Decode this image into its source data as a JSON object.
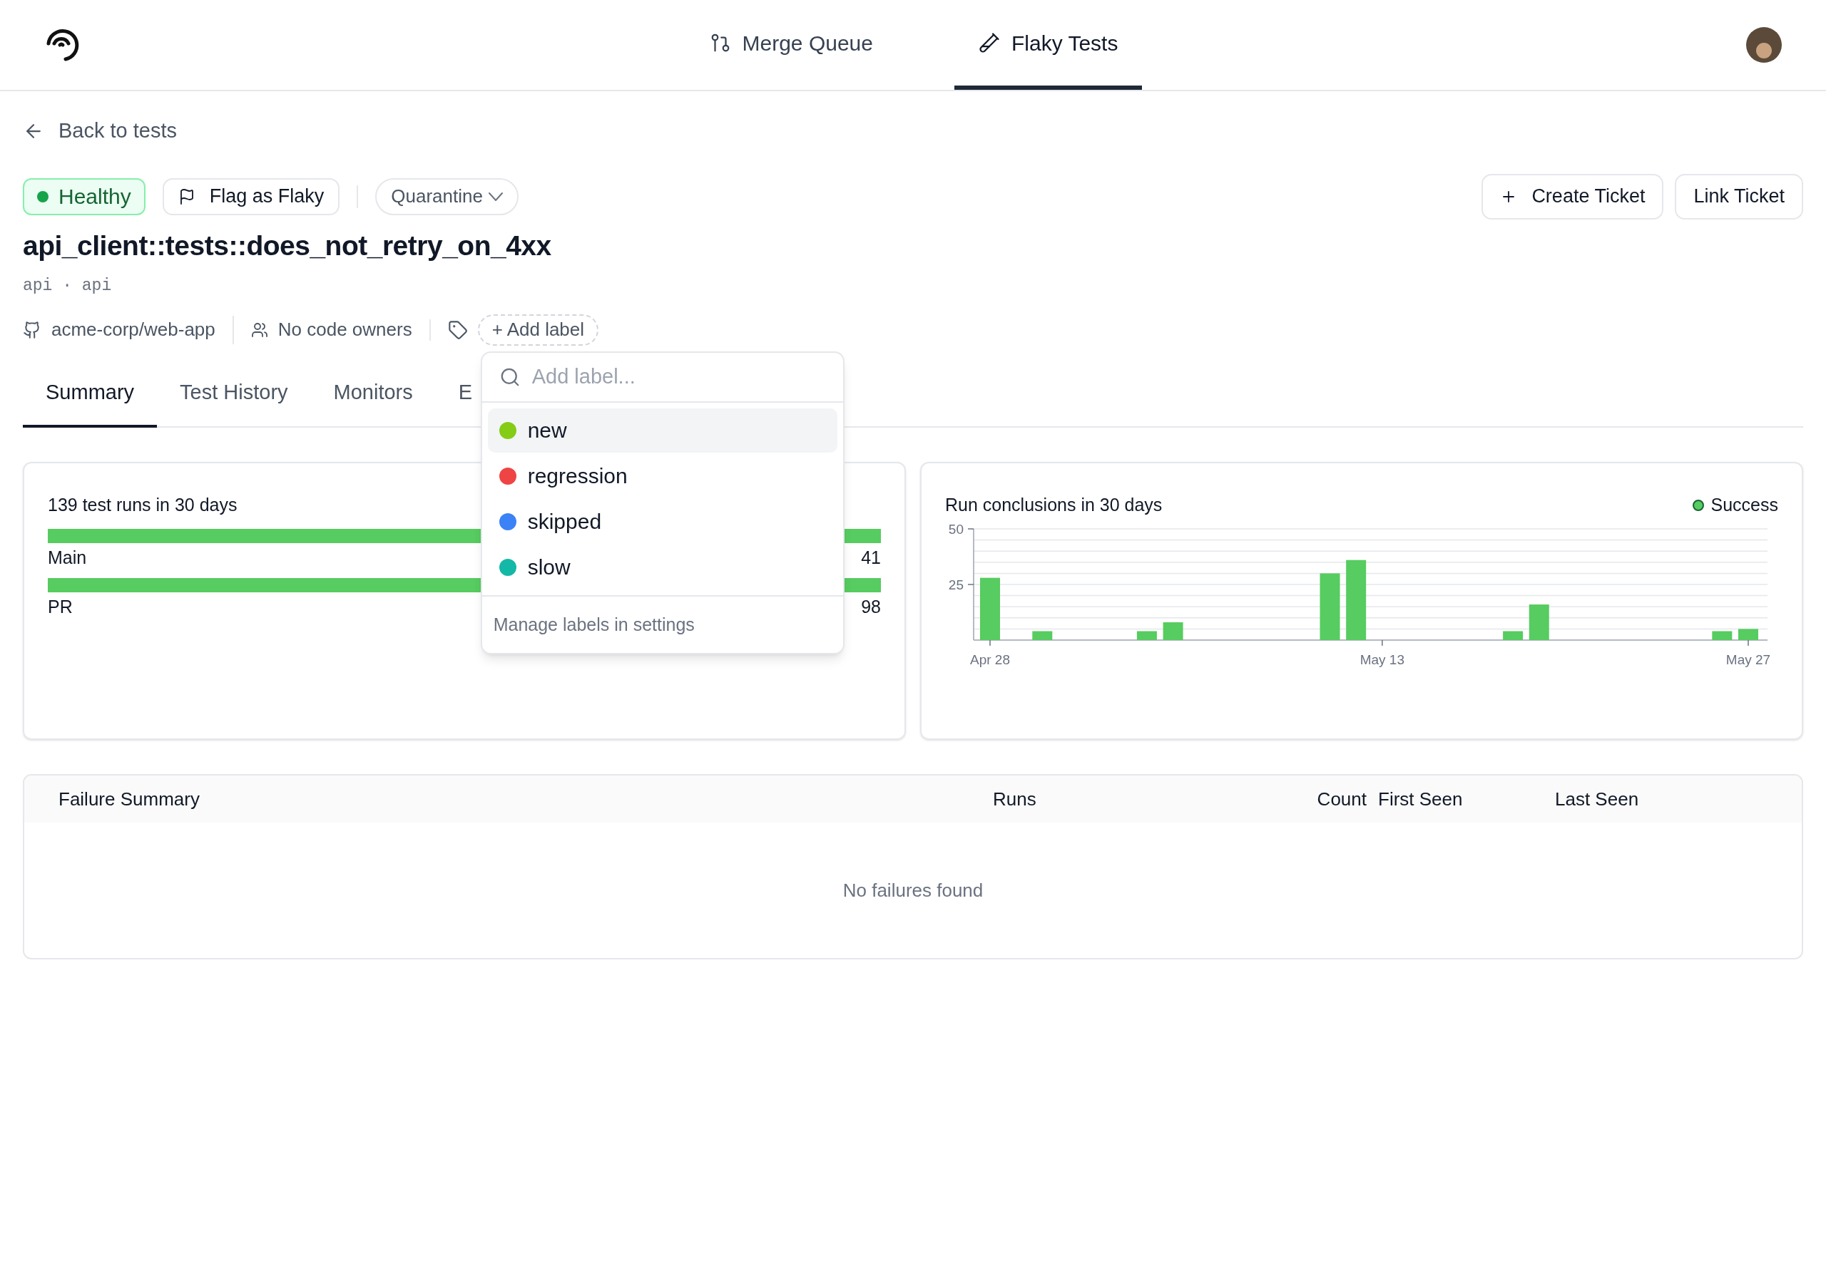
{
  "nav": {
    "tabs": [
      {
        "label": "Merge Queue",
        "selected": false
      },
      {
        "label": "Flaky Tests",
        "selected": true
      }
    ]
  },
  "back_link": "Back to tests",
  "status": {
    "label": "Healthy",
    "kind": "healthy"
  },
  "flag_button": "Flag as Flaky",
  "quarantine": "Quarantine",
  "actions": [
    "Create Ticket",
    "Link Ticket"
  ],
  "test": {
    "name": "api_client::tests::does_not_retry_on_4xx",
    "path": "api · api"
  },
  "meta": {
    "repo": "acme-corp/web-app",
    "owners": "No code owners",
    "add_label": "+ Add label"
  },
  "label_menu": {
    "placeholder": "Add label...",
    "items": [
      {
        "label": "new",
        "color": "#84cc16",
        "selected": true
      },
      {
        "label": "regression",
        "color": "#ef4444",
        "selected": false
      },
      {
        "label": "skipped",
        "color": "#3b82f6",
        "selected": false
      },
      {
        "label": "slow",
        "color": "#14b8a6",
        "selected": false
      }
    ],
    "footer": "Manage labels in settings"
  },
  "tabs": [
    {
      "label": "Summary",
      "selected": true
    },
    {
      "label": "Test History",
      "selected": false
    },
    {
      "label": "Monitors",
      "selected": false
    },
    {
      "label": "E",
      "selected": false
    }
  ],
  "runs_card": {
    "title": "139 test runs in 30 days",
    "rows": [
      {
        "label": "Main",
        "count": "41",
        "level": 1
      },
      {
        "label": "PR",
        "count": "98",
        "level": 1
      }
    ]
  },
  "conclusions_card": {
    "chart_data": {
      "type": "bar",
      "title": "Run conclusions in 30 days",
      "categories": [
        "Apr 28",
        null,
        null,
        null,
        null,
        null,
        null,
        null,
        null,
        null,
        null,
        null,
        null,
        null,
        null,
        "May 13",
        null,
        null,
        null,
        null,
        null,
        null,
        null,
        null,
        null,
        null,
        null,
        null,
        null,
        "May 27"
      ],
      "series": [
        {
          "name": "Success",
          "color": "#57cc60",
          "values": [
            28,
            0,
            4,
            0,
            0,
            0,
            4,
            8,
            0,
            0,
            0,
            0,
            0,
            30,
            36,
            0,
            0,
            0,
            0,
            0,
            4,
            16,
            0,
            0,
            0,
            0,
            0,
            0,
            4,
            5
          ]
        }
      ],
      "ylim": [
        0,
        50
      ],
      "yticks": [
        25,
        50
      ]
    }
  },
  "failures": {
    "columns": [
      "Failure Summary",
      "Runs",
      "Count",
      "First Seen",
      "Last Seen"
    ],
    "empty": "No failures found"
  }
}
